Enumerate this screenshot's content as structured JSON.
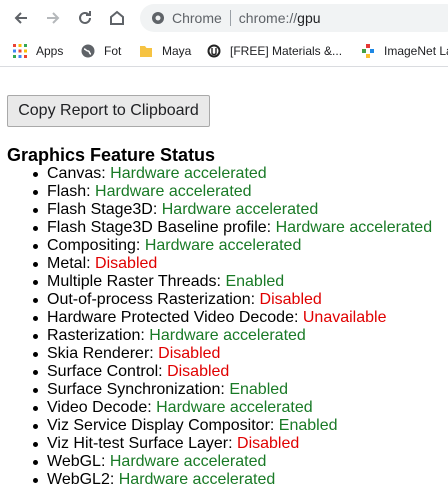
{
  "browser": {
    "omnibox": {
      "chip": "Chrome",
      "url_scheme": "chrome://",
      "url_host": "gpu"
    },
    "bookmarks": [
      {
        "label": "Apps",
        "icon": "apps-grid-icon"
      },
      {
        "label": "Fot",
        "icon": "globe-icon"
      },
      {
        "label": "Maya",
        "icon": "folder-icon"
      },
      {
        "label": "[FREE] Materials &...",
        "icon": "unreal-logo-icon"
      },
      {
        "label": "ImageNet La",
        "icon": "imagenet-logo-icon"
      }
    ]
  },
  "page": {
    "copy_button": "Copy Report to Clipboard",
    "section_title": "Graphics Feature Status",
    "features": [
      {
        "name": "Canvas:",
        "status": "Hardware accelerated",
        "tone": "green"
      },
      {
        "name": "Flash:",
        "status": "Hardware accelerated",
        "tone": "green"
      },
      {
        "name": "Flash Stage3D:",
        "status": "Hardware accelerated",
        "tone": "green"
      },
      {
        "name": "Flash Stage3D Baseline profile:",
        "status": "Hardware accelerated",
        "tone": "green"
      },
      {
        "name": "Compositing:",
        "status": "Hardware accelerated",
        "tone": "green"
      },
      {
        "name": "Metal:",
        "status": "Disabled",
        "tone": "red"
      },
      {
        "name": "Multiple Raster Threads:",
        "status": "Enabled",
        "tone": "green"
      },
      {
        "name": "Out-of-process Rasterization:",
        "status": "Disabled",
        "tone": "red"
      },
      {
        "name": "Hardware Protected Video Decode:",
        "status": "Unavailable",
        "tone": "red"
      },
      {
        "name": "Rasterization:",
        "status": "Hardware accelerated",
        "tone": "green"
      },
      {
        "name": "Skia Renderer:",
        "status": "Disabled",
        "tone": "red"
      },
      {
        "name": "Surface Control:",
        "status": "Disabled",
        "tone": "red"
      },
      {
        "name": "Surface Synchronization:",
        "status": "Enabled",
        "tone": "green"
      },
      {
        "name": "Video Decode:",
        "status": "Hardware accelerated",
        "tone": "green"
      },
      {
        "name": "Viz Service Display Compositor:",
        "status": "Enabled",
        "tone": "green"
      },
      {
        "name": "Viz Hit-test Surface Layer:",
        "status": "Disabled",
        "tone": "red"
      },
      {
        "name": "WebGL:",
        "status": "Hardware accelerated",
        "tone": "green"
      },
      {
        "name": "WebGL2:",
        "status": "Hardware accelerated",
        "tone": "green"
      }
    ]
  },
  "colors": {
    "green": "#197a26",
    "red": "#e00000"
  }
}
